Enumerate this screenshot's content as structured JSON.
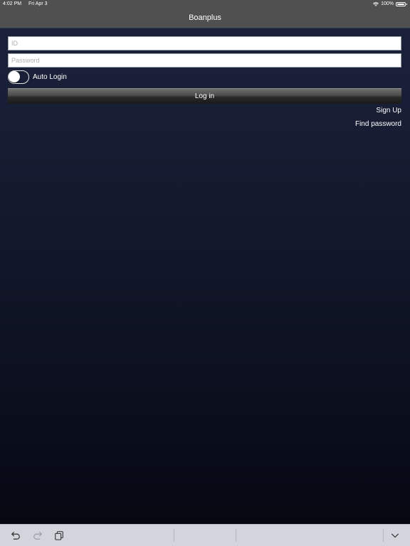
{
  "status_bar": {
    "time": "4:02 PM",
    "date": "Fri Apr 3",
    "battery": "100%",
    "battery_level": 1.0
  },
  "nav": {
    "title": "Boanplus"
  },
  "form": {
    "id_placeholder": "ID",
    "id_value": "",
    "password_placeholder": "Password",
    "password_value": "",
    "auto_login_label": "Auto Login",
    "auto_login_on": false,
    "login_label": "Log in"
  },
  "links": {
    "sign_up": "Sign Up",
    "find_password": "Find password"
  },
  "keyboard_bar": {
    "icons": [
      "undo-icon",
      "redo-icon",
      "paste-icon",
      "chevron-down-icon"
    ]
  },
  "colors": {
    "nav_background": "#505050",
    "page_background_top": "#1a2038",
    "page_background_bottom": "#04060e",
    "keyboard_bar": "#d2d5db"
  }
}
